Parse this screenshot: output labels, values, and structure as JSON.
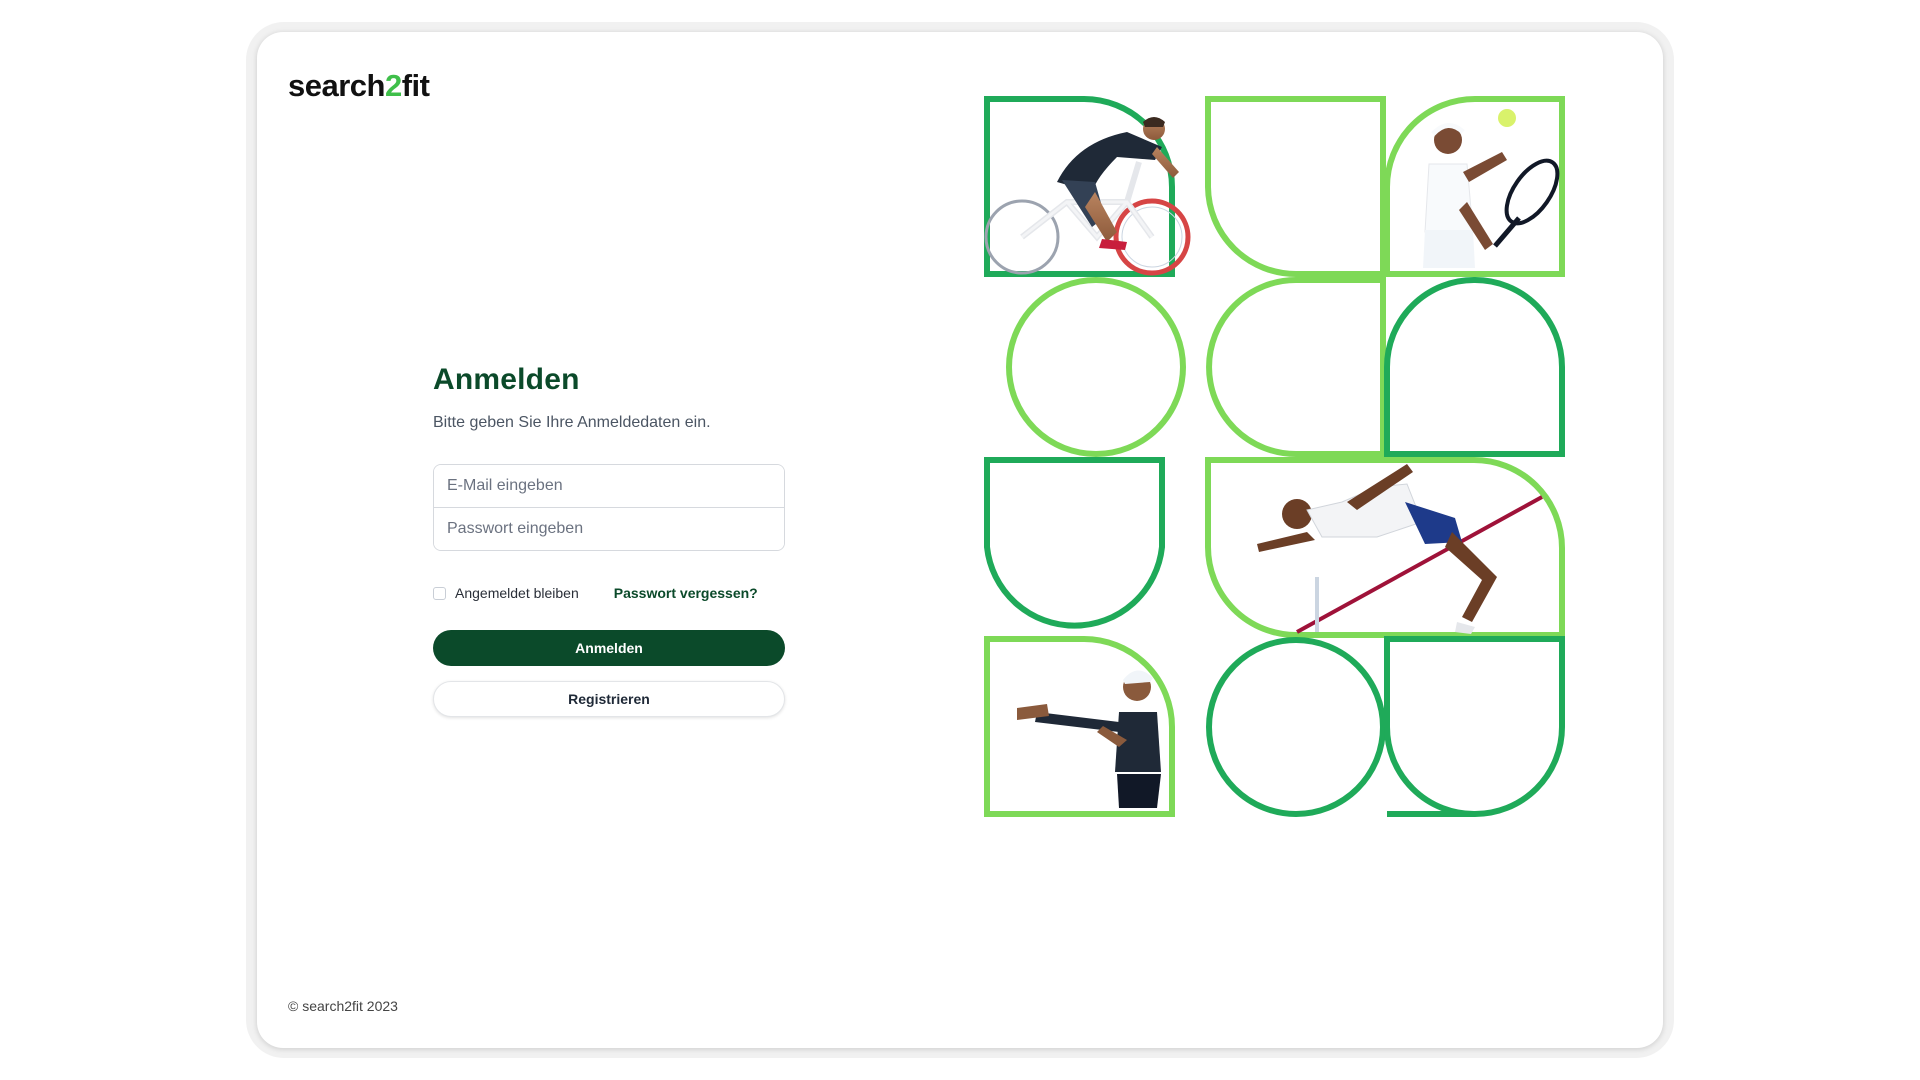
{
  "brand": {
    "logo_part1": "search",
    "logo_part2": "2",
    "logo_part3": "fit",
    "accent_color": "#3fbf4a",
    "primary_color": "#0b4a2a"
  },
  "login": {
    "title": "Anmelden",
    "subtitle": "Bitte geben Sie Ihre Anmeldedaten ein.",
    "email_placeholder": "E-Mail eingeben",
    "password_placeholder": "Passwort eingeben",
    "remember_label": "Angemeldet bleiben",
    "remember_checked": false,
    "forgot_label": "Passwort vergessen?",
    "submit_label": "Anmelden",
    "register_label": "Registrieren"
  },
  "footer": {
    "copyright": "© search2fit 2023"
  },
  "gallery": {
    "colors": {
      "light_green": "#7ed957",
      "dark_green": "#1faa59"
    },
    "tiles": [
      {
        "name": "tile-cyclist",
        "shape": "arch-right",
        "color": "dark",
        "photo": "cyclist-photo"
      },
      {
        "name": "tile-arch-1",
        "shape": "arch-bottom-left",
        "color": "light"
      },
      {
        "name": "tile-tennis",
        "shape": "arch-top-left",
        "color": "light",
        "photo": "tennis-player-photo"
      },
      {
        "name": "tile-circle-1",
        "shape": "circle",
        "color": "light"
      },
      {
        "name": "tile-half-1",
        "shape": "half-left",
        "color": "light"
      },
      {
        "name": "tile-arch-2",
        "shape": "arch-top-left",
        "color": "dark"
      },
      {
        "name": "tile-arch-3",
        "shape": "arch-bottom",
        "color": "dark"
      },
      {
        "name": "tile-high-jumper",
        "shape": "wide-arch",
        "color": "light",
        "photo": "high-jumper-photo"
      },
      {
        "name": "tile-stretching",
        "shape": "arch-top-right",
        "color": "light",
        "photo": "stretching-woman-photo"
      },
      {
        "name": "tile-circle-2",
        "shape": "circle",
        "color": "dark"
      },
      {
        "name": "tile-arch-4",
        "shape": "arch-bottom",
        "color": "dark"
      }
    ]
  }
}
